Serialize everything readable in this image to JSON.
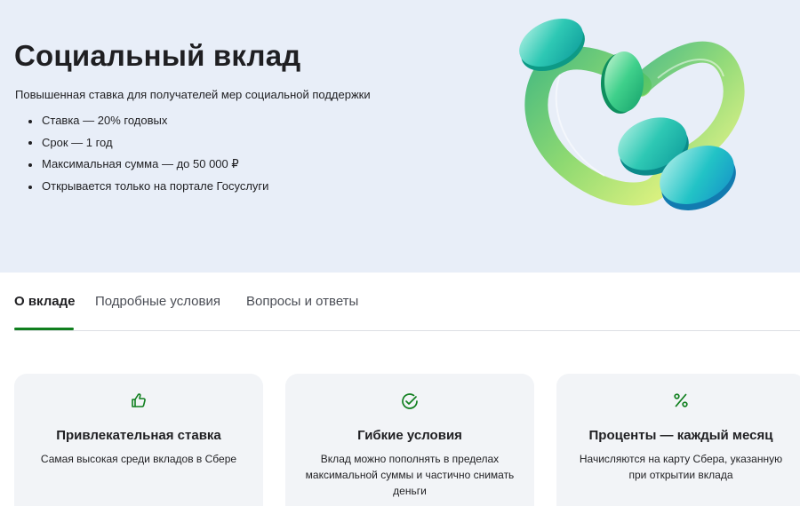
{
  "hero": {
    "title": "Социальный вклад",
    "subtitle": "Повышенная ставка для получателей мер социальной поддержки",
    "bullets": [
      "Ставка — 20% годовых",
      "Срок — 1 год",
      "Максимальная сумма — до 50 000 ₽",
      "Открывается только на портале Госуслуги"
    ],
    "background_color": "#e8eef8",
    "illustration": "green-ribbon-heart-with-coins"
  },
  "tabs": [
    {
      "label": "О вкладе",
      "active": true
    },
    {
      "label": "Подробные условия",
      "active": false
    },
    {
      "label": "Вопросы и ответы",
      "active": false
    }
  ],
  "accent_color": "#107f1e",
  "cards": [
    {
      "icon": "thumbs-up-icon",
      "title": "Привлекательная ставка",
      "text": "Самая высокая среди вкладов в Сбере"
    },
    {
      "icon": "check-circle-icon",
      "title": "Гибкие условия",
      "text": "Вклад можно пополнять в пределах максимальной суммы и частично снимать деньги"
    },
    {
      "icon": "percent-icon",
      "title": "Проценты — каждый месяц",
      "text": "Начисляются на карту Сбера, указанную при открытии вклада"
    }
  ]
}
